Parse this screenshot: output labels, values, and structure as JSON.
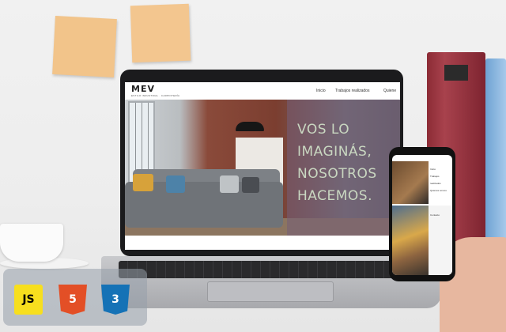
{
  "website": {
    "logo": "MEV",
    "logo_tagline": "ESTILO INDUSTRIAL · CARPINTERÍA",
    "nav": [
      "Inicio",
      "Trabajos realizados",
      "Quiene"
    ],
    "hero_headline_lines": [
      "VOS LO",
      "IMAGINÁS,",
      "NOSOTROS",
      "HACEMOS."
    ]
  },
  "phone_site": {
    "menu_items": [
      "Inicio",
      "Trabajos realizados",
      "Quienes somos",
      "Contacto"
    ]
  },
  "tech_badges": [
    {
      "label": "JS",
      "icon": "javascript-logo",
      "color": "#f7df1e",
      "text_color": "#000000"
    },
    {
      "label": "5",
      "icon": "html5-logo",
      "color": "#e34f26",
      "text_color": "#ffffff"
    },
    {
      "label": "3",
      "icon": "css3-logo",
      "color": "#1572b6",
      "text_color": "#ffffff"
    }
  ],
  "colors": {
    "hero_overlay": "#745c78",
    "headline_text": "#c9d7c1",
    "sticky_note": "#f2c48a"
  }
}
